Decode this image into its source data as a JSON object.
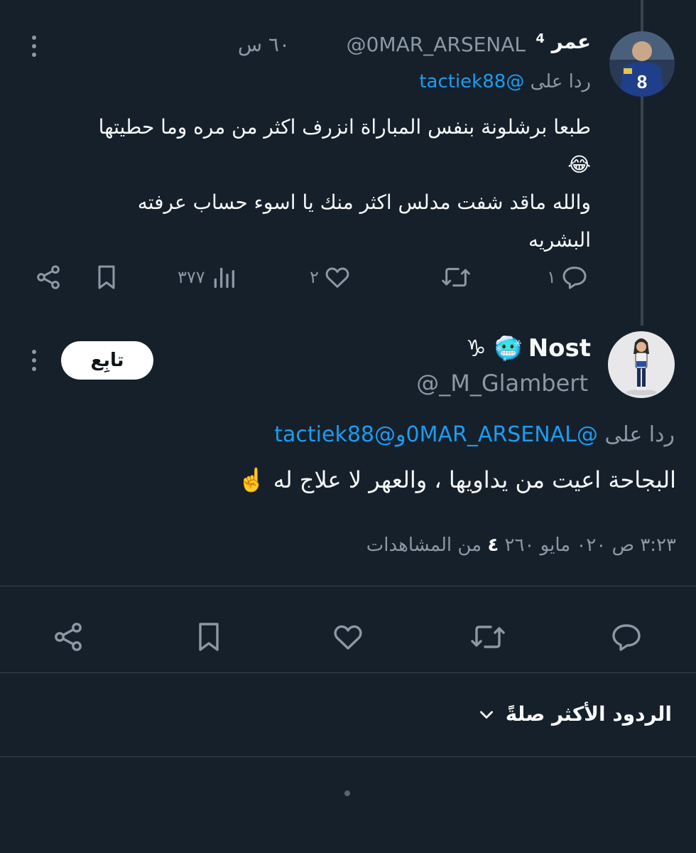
{
  "tweet1": {
    "display_name": "عمر",
    "name_badge": "4",
    "handle": "@0MAR_ARSENAL",
    "time_ago": "٦٠ س",
    "replying_prefix": "ردا على",
    "replying_to": "@tactiek88",
    "body_lines": [
      "طبعا برشلونة بنفس المباراة انزرف اكثر من مره وما حطيتها",
      "😂",
      "والله ماقد شفت مدلس اكثر منك يا اسوء حساب عرفته",
      "البشريه"
    ],
    "actions": {
      "reply_count": "١",
      "retweet_count": "",
      "like_count": "٢",
      "views_count": "٣٧٧"
    },
    "icons": [
      "more-icon",
      "reply-icon",
      "retweet-icon",
      "like-icon",
      "views-icon",
      "bookmark-icon",
      "share-icon"
    ]
  },
  "tweet2": {
    "display_name": "Nost",
    "name_emojis": "♑ 🥶",
    "handle": "@_M_Glambert",
    "follow_label": "تابِع",
    "replying_prefix": "ردا على",
    "replying_to_1": "@0MAR_ARSENAL",
    "replying_and": "و",
    "replying_to_2": "@tactiek88",
    "body": "البجاحة اعيت من يداويها ، والعهر لا علاج له ☝️",
    "timestamp": "٣:٢٣ ص ٠٢٠ مايو ٢٦٠",
    "views_value": "٤",
    "views_label": "من المشاهدات"
  },
  "replies_sort": {
    "label": "الردود الأكثر صلةً"
  },
  "colors": {
    "background": "#15202b",
    "text": "#f7f9f9",
    "muted": "#8b98a5",
    "link": "#1d9bf0",
    "divider": "#38444d"
  }
}
